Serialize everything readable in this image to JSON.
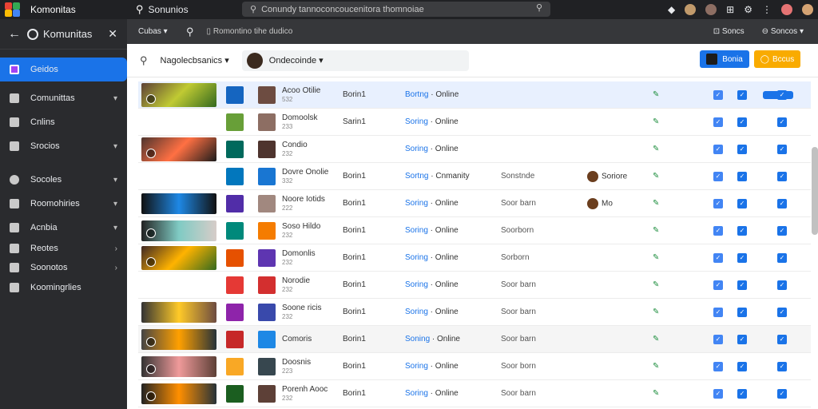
{
  "app": {
    "title": "Komonitas",
    "top_link": "Sonunios"
  },
  "omnibox": {
    "value": "Conundy tannoconcoucenitora thomnoiae"
  },
  "sidebar": {
    "header": "Komunitas",
    "items": [
      {
        "label": "Geidos"
      },
      {
        "label": "Comunittas"
      },
      {
        "label": "Cnlins"
      },
      {
        "label": "Srocios"
      },
      {
        "label": "Socoles"
      },
      {
        "label": "Roomohiries"
      },
      {
        "label": "Acnbia"
      },
      {
        "label": "Reotes"
      },
      {
        "label": "Soonotos"
      },
      {
        "label": "Koomingrlies"
      }
    ]
  },
  "subbar": {
    "dropdown": "Cubas",
    "breadcrumb": "Romontino tihe dudico",
    "right": [
      "Soncs",
      "Soncos"
    ]
  },
  "filters": {
    "dropdown": "Nagolecbsanics",
    "select": "Ondecoinde",
    "btn_primary": "Bonia",
    "btn_secondary": "Bccus"
  },
  "rows": [
    {
      "name": "Acoo Otilie",
      "sub": "532",
      "col1": "Borin1",
      "status_b": "Bortng",
      "status": "Online",
      "col4": "",
      "col5": ""
    },
    {
      "name": "Domoolsk",
      "sub": "233",
      "col1": "Sarin1",
      "status_b": "Soring",
      "status": "Online",
      "col4": "",
      "col5": ""
    },
    {
      "name": "Condio",
      "sub": "232",
      "col1": "",
      "status_b": "Soring",
      "status": "Online",
      "col4": "",
      "col5": ""
    },
    {
      "name": "Dovre Onolie",
      "sub": "332",
      "col1": "Borin1",
      "status_b": "Sortng",
      "status": "Cnmanity",
      "col4": "Sonstnde",
      "col5": "Soriore"
    },
    {
      "name": "Noore Iotids",
      "sub": "222",
      "col1": "Borin1",
      "status_b": "Soring",
      "status": "Online",
      "col4": "Soor barn",
      "col5": "Mo"
    },
    {
      "name": "Soso Hildo",
      "sub": "232",
      "col1": "Borin1",
      "status_b": "Soring",
      "status": "Online",
      "col4": "Soorborn",
      "col5": ""
    },
    {
      "name": "Domonlis",
      "sub": "232",
      "col1": "Borin1",
      "status_b": "Soring",
      "status": "Online",
      "col4": "Sorborn",
      "col5": ""
    },
    {
      "name": "Norodie",
      "sub": "232",
      "col1": "Borin1",
      "status_b": "Soring",
      "status": "Online",
      "col4": "Soor barn",
      "col5": ""
    },
    {
      "name": "Soone ricis",
      "sub": "232",
      "col1": "Borin1",
      "status_b": "Soring",
      "status": "Online",
      "col4": "Soor barn",
      "col5": ""
    },
    {
      "name": "Comoris",
      "sub": "",
      "col1": "Borin1",
      "status_b": "Soning",
      "status": "Online",
      "col4": "Soor barn",
      "col5": ""
    },
    {
      "name": "Doosnis",
      "sub": "223",
      "col1": "Borin1",
      "status_b": "Soring",
      "status": "Online",
      "col4": "Soor born",
      "col5": ""
    },
    {
      "name": "Porenh Aooc",
      "sub": "232",
      "col1": "Borin1",
      "status_b": "Soring",
      "status": "Online",
      "col4": "Soor barn",
      "col5": ""
    }
  ]
}
